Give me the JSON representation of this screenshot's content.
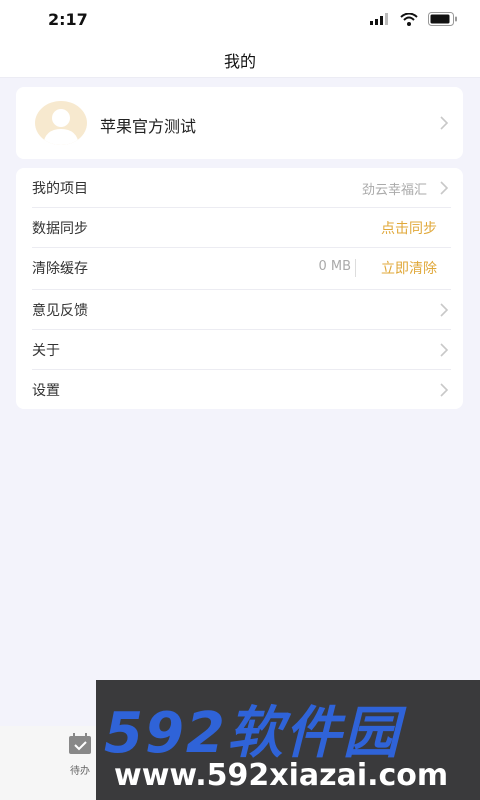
{
  "status_bar": {
    "time": "2:17"
  },
  "nav": {
    "title": "我的"
  },
  "profile": {
    "name": "苹果官方测试",
    "avatar_icon": "user-avatar-icon"
  },
  "menu": {
    "project_label": "我的项目",
    "project_value": "劲云幸福汇",
    "sync_label": "数据同步",
    "sync_action": "点击同步",
    "cache_label": "清除缓存",
    "cache_size": "0 MB",
    "cache_action": "立即清除",
    "feedback_label": "意见反馈",
    "about_label": "关于",
    "settings_label": "设置"
  },
  "tabbar": {
    "todo_label": "待办"
  },
  "watermark": {
    "top": "592软件园",
    "bottom": "www.592xiazai.com"
  },
  "colors": {
    "accent": "#e0a83a",
    "background": "#f3f3fb",
    "watermark_blue": "#2f63d8"
  }
}
